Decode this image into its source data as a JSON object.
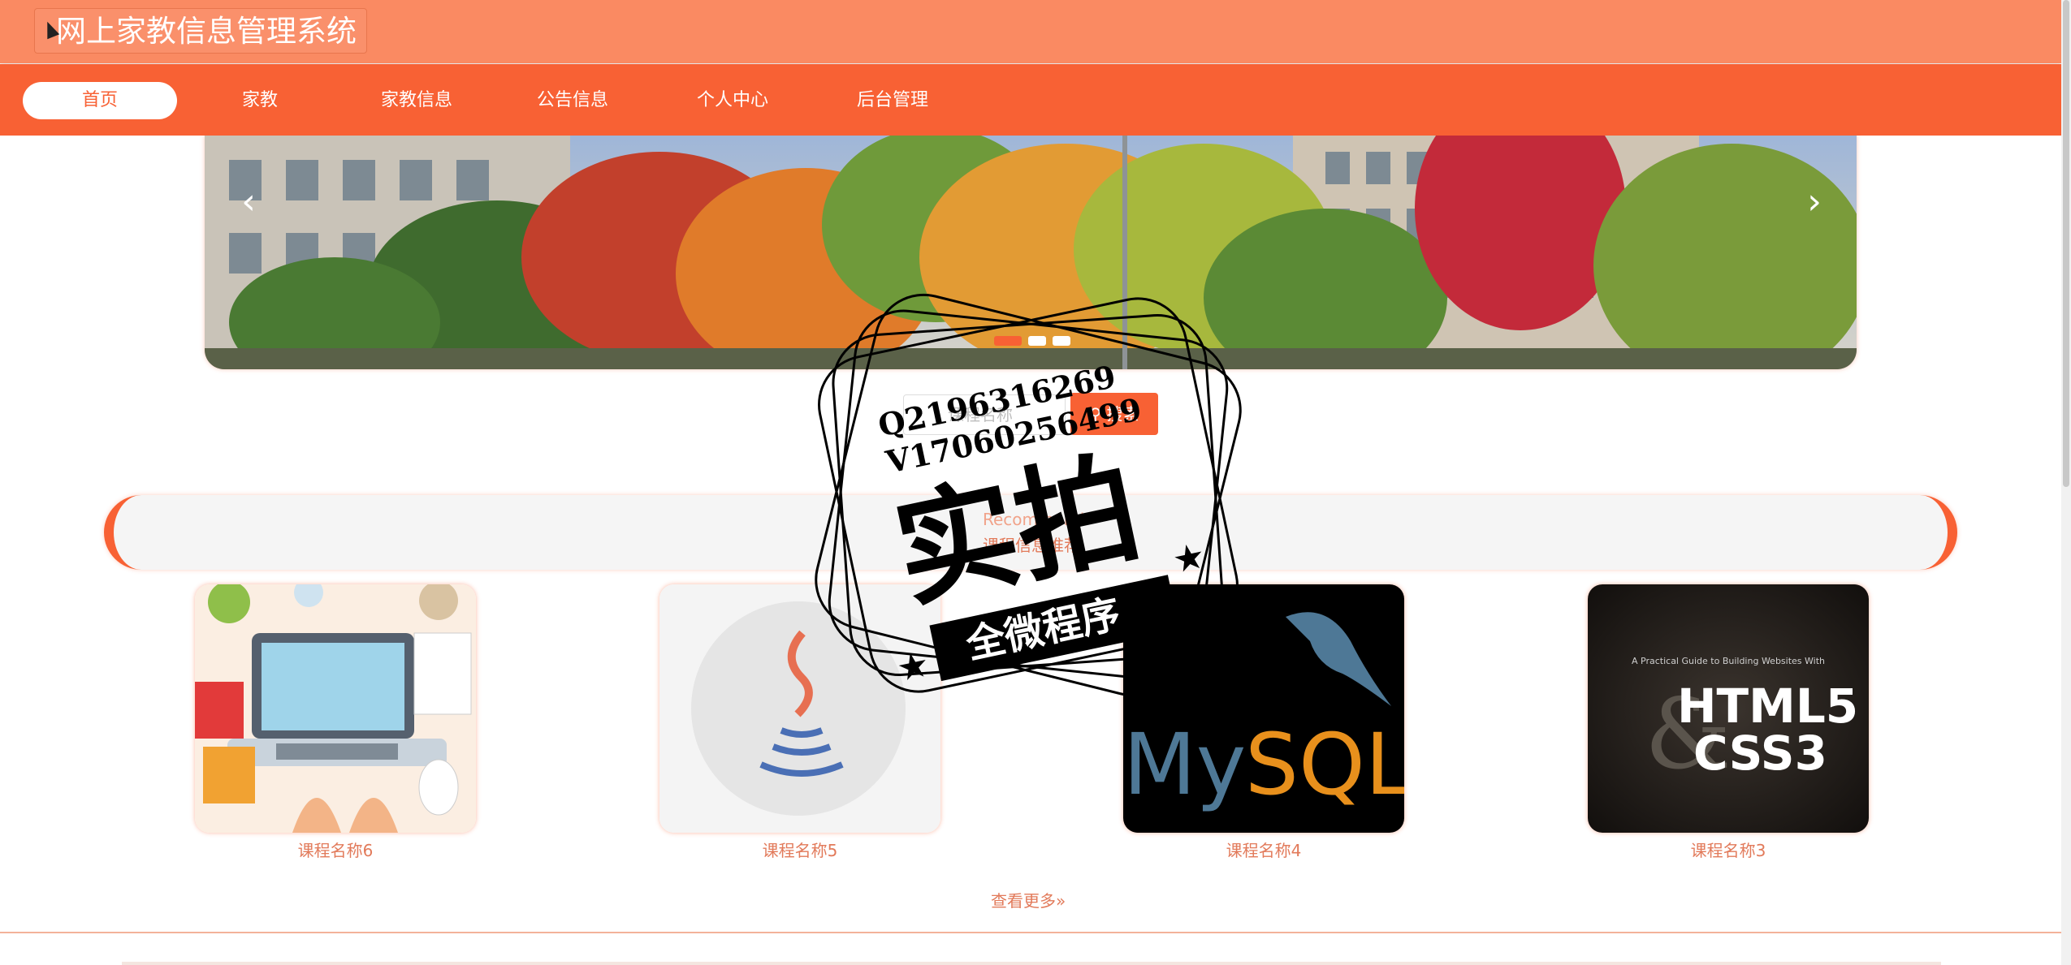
{
  "app": {
    "title": "网上家教信息管理系统"
  },
  "nav": {
    "items": [
      {
        "label": "首页",
        "active": true
      },
      {
        "label": "家教",
        "active": false
      },
      {
        "label": "家教信息",
        "active": false
      },
      {
        "label": "公告信息",
        "active": false
      },
      {
        "label": "个人中心",
        "active": false
      },
      {
        "label": "后台管理",
        "active": false
      }
    ]
  },
  "banner": {
    "prev_icon": "chevron-left-icon",
    "next_icon": "chevron-right-icon",
    "slide_count": 3,
    "active_slide": 1
  },
  "search": {
    "placeholder": "课程名称",
    "button_label": "搜索"
  },
  "section": {
    "title_en": "Recommend",
    "title_cn": "课程信息推荐"
  },
  "courses": [
    {
      "name": "课程名称6"
    },
    {
      "name": "课程名称5"
    },
    {
      "name": "课程名称4",
      "logo_text": "MySQL"
    },
    {
      "name": "课程名称3",
      "cover_subtitle": "A Practical Guide to Building Websites With",
      "cover_text_1": "HTML5",
      "cover_text_2": "CSS3",
      "cover_amp": "&"
    }
  ],
  "more_link": "查看更多",
  "watermark": {
    "line1": "Q2196316269",
    "line2": "V17060256499",
    "big": "实拍",
    "ribbon": "全微程序"
  },
  "colors": {
    "header_bg": "#fa8a62",
    "nav_bg": "#f86134",
    "accent": "#f86134",
    "label_text": "#e27a5a"
  }
}
